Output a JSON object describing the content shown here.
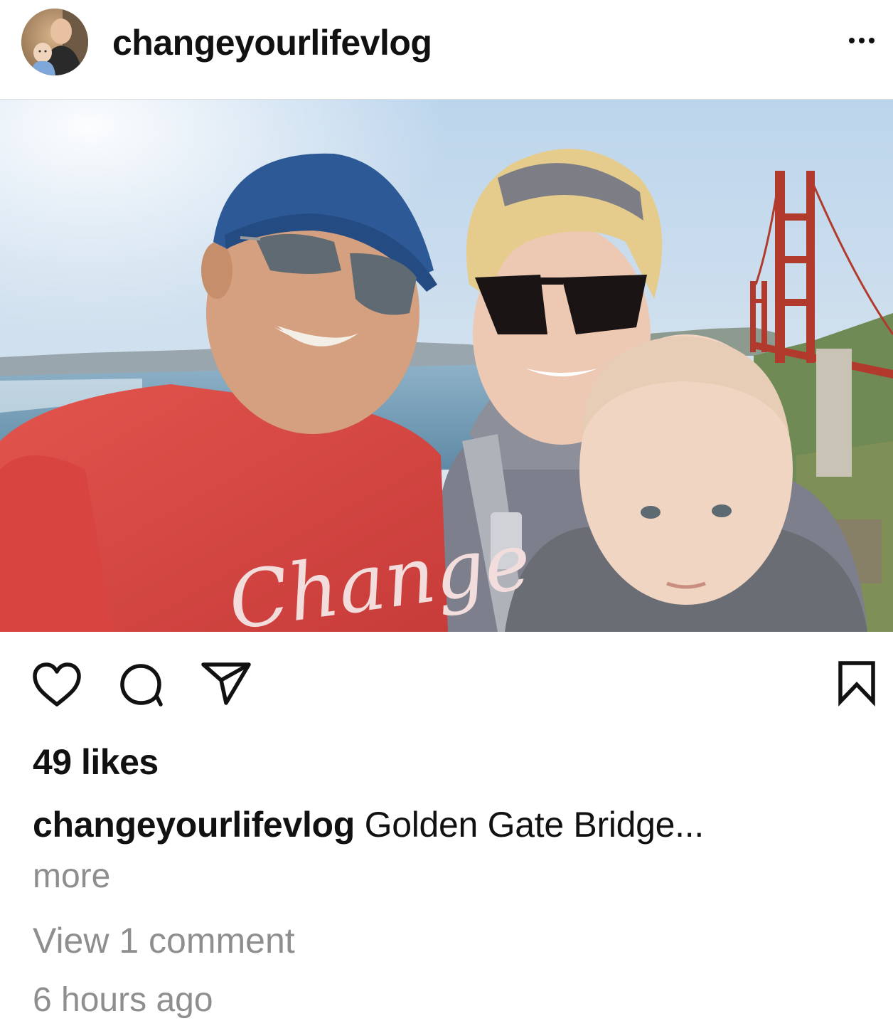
{
  "post": {
    "username": "changeyourlifevlog",
    "likes": "49 likes",
    "caption_user": "changeyourlifevlog",
    "caption_text": " Golden Gate Bridge...",
    "more": "more",
    "view_comments": "View 1 comment",
    "timestamp": "6 hours ago",
    "shirt_text": "Change"
  },
  "icons": {
    "more": "more-options-icon",
    "like": "heart-icon",
    "comment": "comment-icon",
    "share": "send-icon",
    "save": "bookmark-icon"
  },
  "colors": {
    "text": "#111111",
    "secondary": "#8e8e8e",
    "divider": "#dbdbdb",
    "bridge": "#b23a2c"
  }
}
